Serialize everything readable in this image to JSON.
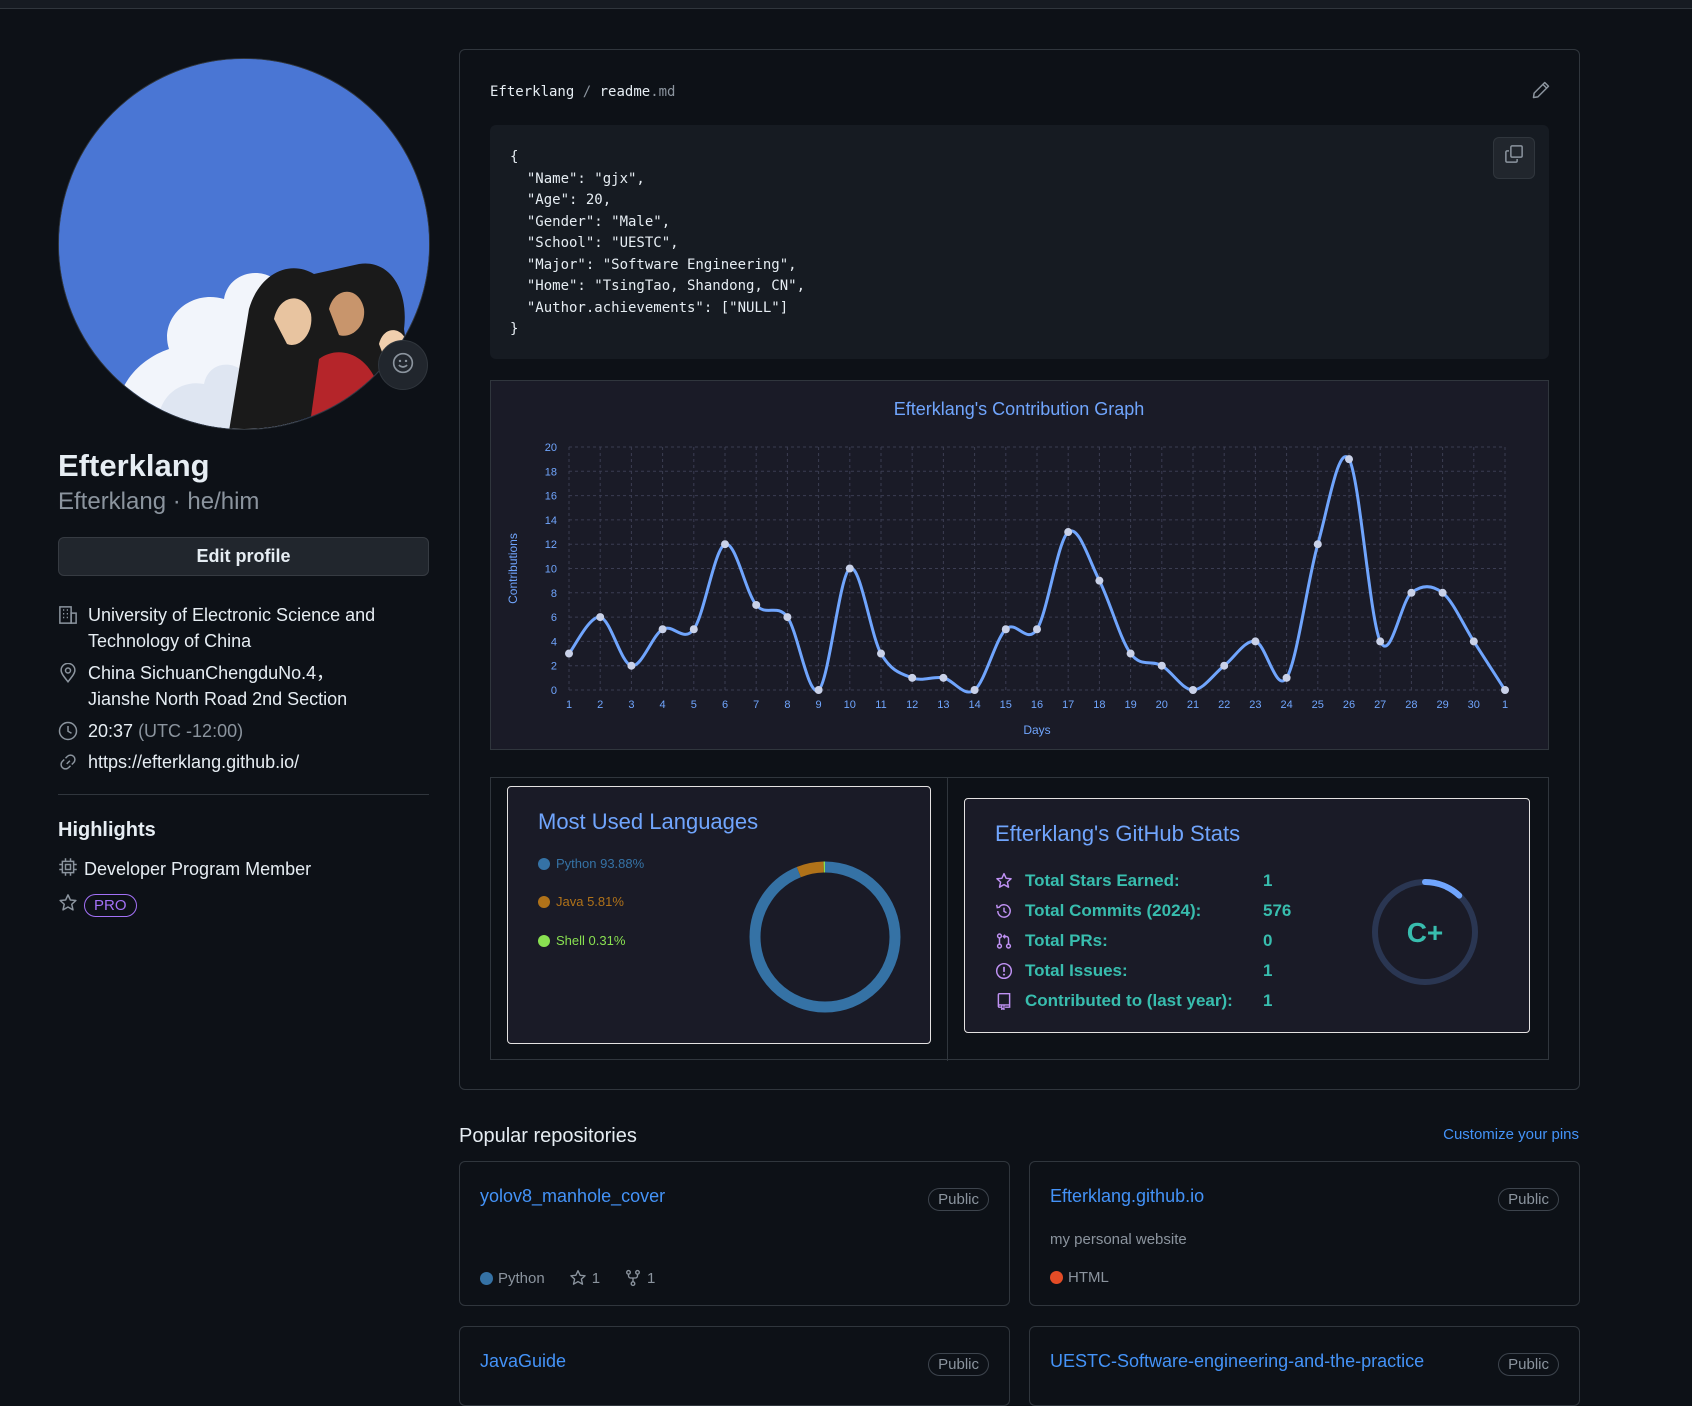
{
  "profile": {
    "name": "Efterklang",
    "login_line": "Efterklang · he/him",
    "edit_label": "Edit profile",
    "org": "University of Electronic Science and Technology of China",
    "location": "China SichuanChengduNo.4， Jianshe North Road 2nd Section",
    "time": "20:37",
    "timezone": "(UTC -12:00)",
    "website": "https://efterklang.github.io/",
    "highlights_title": "Highlights",
    "highlight_member": "Developer Program Member",
    "pro_badge": "PRO"
  },
  "readme": {
    "owner": "Efterklang",
    "sep": "/",
    "file": "readme",
    "ext": ".md",
    "code_lines": [
      "{",
      "  \"Name\": \"gjx\",",
      "  \"Age\": 20,",
      "  \"Gender\": \"Male\",",
      "  \"School\": \"UESTC\",",
      "  \"Major\": \"Software Engineering\",",
      "  \"Home\": \"TsingTao, Shandong, CN\",",
      "  \"Author.achievements\": [\"NULL\"]",
      "}"
    ]
  },
  "chart_data": {
    "type": "line",
    "title": "Efterklang's Contribution Graph",
    "xlabel": "Days",
    "ylabel": "Contributions",
    "x": [
      "1",
      "2",
      "3",
      "4",
      "5",
      "6",
      "7",
      "8",
      "9",
      "10",
      "11",
      "12",
      "13",
      "14",
      "15",
      "16",
      "17",
      "18",
      "19",
      "20",
      "21",
      "22",
      "23",
      "24",
      "25",
      "26",
      "27",
      "28",
      "29",
      "30",
      "1"
    ],
    "values": [
      3,
      6,
      2,
      5,
      5,
      12,
      7,
      6,
      0,
      10,
      3,
      1,
      1,
      0,
      5,
      5,
      13,
      9,
      3,
      2,
      0,
      2,
      4,
      1,
      12,
      19,
      4,
      8,
      8,
      4,
      0
    ],
    "ylim": [
      0,
      20
    ],
    "yticks": [
      0,
      2,
      4,
      6,
      8,
      10,
      12,
      14,
      16,
      18,
      20
    ],
    "grid": true,
    "line_color": "#70a5fd",
    "bg_color": "#1a1b27"
  },
  "languages": {
    "title": "Most Used Languages",
    "items": [
      {
        "name": "Python 93.88%",
        "percent": 93.88,
        "color": "#3572A5"
      },
      {
        "name": "Java 5.81%",
        "percent": 5.81,
        "color": "#b07219"
      },
      {
        "name": "Shell 0.31%",
        "percent": 0.31,
        "color": "#89e051"
      }
    ]
  },
  "gh_stats": {
    "title": "Efterklang's GitHub Stats",
    "rows": [
      {
        "label": "Total Stars Earned:",
        "value": "1",
        "icon": "star-icon"
      },
      {
        "label": "Total Commits (2024):",
        "value": "576",
        "icon": "history-icon"
      },
      {
        "label": "Total PRs:",
        "value": "0",
        "icon": "pr-icon"
      },
      {
        "label": "Total Issues:",
        "value": "1",
        "icon": "issue-icon"
      },
      {
        "label": "Contributed to (last year):",
        "value": "1",
        "icon": "repo-icon"
      }
    ],
    "rank": "C+",
    "rank_progress": 0.12
  },
  "popular": {
    "title": "Popular repositories",
    "customize": "Customize your pins",
    "repos": [
      {
        "name": "yolov8_manhole_cover",
        "visibility": "Public",
        "description": "",
        "language": "Python",
        "lang_color": "#3572A5",
        "stars": "1",
        "forks": "1"
      },
      {
        "name": "Efterklang.github.io",
        "visibility": "Public",
        "description": "my personal website",
        "language": "HTML",
        "lang_color": "#e34c26"
      },
      {
        "name": "JavaGuide",
        "visibility": "Public"
      },
      {
        "name": "UESTC-Software-engineering-and-the-practice",
        "visibility": "Public"
      }
    ]
  }
}
